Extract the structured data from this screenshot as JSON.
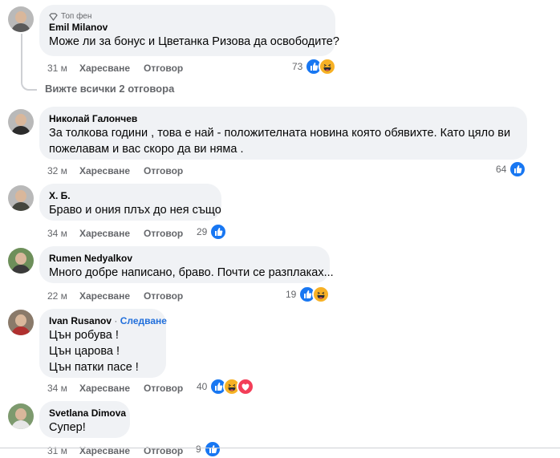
{
  "comments": [
    {
      "badge": "Топ фен",
      "author": "Emil Milanov",
      "lines": [
        "Може ли за бонус и Цветанка Ризова да освободите?"
      ],
      "time": "31 м",
      "like_label": "Харесване",
      "reply_label": "Отговор",
      "reaction_count": "73",
      "reactions": [
        "like-icon",
        "haha-icon"
      ]
    },
    {
      "author": "Николай Галончев",
      "lines": [
        "За толкова години , това е най - положителната новина която обявихте. Като цяло ви",
        "пожелавам и вас скоро да ви няма ."
      ],
      "time": "32 м",
      "like_label": "Харесване",
      "reply_label": "Отговор",
      "reaction_count": "64",
      "reactions": [
        "like-icon"
      ]
    },
    {
      "author": "Х. Б.",
      "lines": [
        "Браво и ония плъх до нея също"
      ],
      "time": "34 м",
      "like_label": "Харесване",
      "reply_label": "Отговор",
      "reaction_count": "29",
      "reactions": [
        "like-icon"
      ]
    },
    {
      "author": "Rumen Nedyalkov",
      "lines": [
        "Много добре написано, браво. Почти се разплаках..."
      ],
      "time": "22 м",
      "like_label": "Харесване",
      "reply_label": "Отговор",
      "reaction_count": "19",
      "reactions": [
        "like-icon",
        "haha-icon"
      ]
    },
    {
      "author": "Ivan Rusanov",
      "follow_label": "Следване",
      "lines": [
        "Цън робува !",
        "Цън царова !",
        "Цън патки пасе !"
      ],
      "time": "34 м",
      "like_label": "Харесване",
      "reply_label": "Отговор",
      "reaction_count": "40",
      "reactions": [
        "like-icon",
        "haha-icon",
        "love-icon"
      ]
    },
    {
      "author": "Svetlana Dimova",
      "lines": [
        "Супер!"
      ],
      "time": "31 м",
      "like_label": "Харесване",
      "reply_label": "Отговор",
      "reaction_count": "9",
      "reactions": [
        "like-icon"
      ]
    }
  ],
  "view_replies": "Вижте всички 2 отговора",
  "colors": {
    "accent": "#1877f2",
    "secondary_text": "#65676b",
    "bubble": "#f0f2f5",
    "follow": "#216fdb"
  }
}
